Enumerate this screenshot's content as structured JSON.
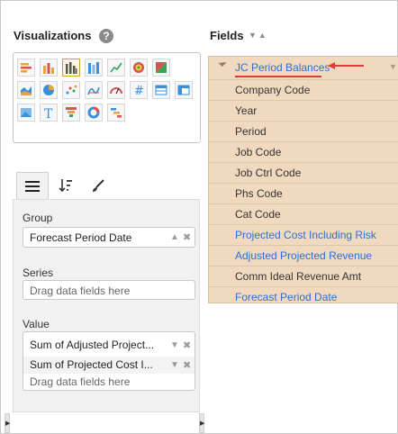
{
  "visualizations": {
    "title": "Visualizations",
    "help_icon": "?",
    "types": [
      {
        "icon": "horizontal-bar-icon"
      },
      {
        "icon": "bar-icon"
      },
      {
        "icon": "stacked-bar-icon",
        "selected": true
      },
      {
        "icon": "clustered-bar-icon"
      },
      {
        "icon": "stacked-column-icon"
      },
      {
        "icon": "line-icon"
      },
      {
        "icon": "gauge-icon"
      },
      {
        "icon": "map-icon"
      },
      {
        "icon": "area-icon"
      },
      {
        "icon": "pie-icon"
      },
      {
        "icon": "scatter-icon"
      },
      {
        "icon": "sparkline-icon"
      },
      {
        "icon": "gauge-meter-icon"
      },
      {
        "icon": "number-icon"
      },
      {
        "icon": "table-icon"
      },
      {
        "icon": "pivot-table-icon"
      },
      {
        "icon": "image-icon"
      },
      {
        "icon": "text-icon"
      },
      {
        "icon": "funnel-icon"
      },
      {
        "icon": "donut-icon"
      },
      {
        "icon": "gantt-icon"
      }
    ]
  },
  "tabs": [
    {
      "icon": "list-icon",
      "active": true
    },
    {
      "icon": "sort-icon",
      "active": false
    },
    {
      "icon": "brush-icon",
      "active": false
    }
  ],
  "group": {
    "label": "Group",
    "value": "Forecast Period Date"
  },
  "series": {
    "label": "Series",
    "placeholder": "Drag data fields here"
  },
  "value": {
    "label": "Value",
    "items": [
      "Sum of Adjusted Project...",
      "Sum of Projected Cost I..."
    ],
    "placeholder": "Drag data fields here"
  },
  "fields": {
    "title": "Fields",
    "sort_glyphs": "▼▲",
    "group_name": "JC Period Balances",
    "items": [
      {
        "label": "Company Code",
        "color": "#333333"
      },
      {
        "label": "Year",
        "color": "#333333"
      },
      {
        "label": "Period",
        "color": "#333333"
      },
      {
        "label": "Job Code",
        "color": "#333333"
      },
      {
        "label": "Job Ctrl Code",
        "color": "#333333"
      },
      {
        "label": "Phs Code",
        "color": "#333333"
      },
      {
        "label": "Cat Code",
        "color": "#333333"
      },
      {
        "label": "Projected Cost Including Risk",
        "color": "#2e6fd1"
      },
      {
        "label": "Adjusted Projected Revenue",
        "color": "#2e6fd1"
      },
      {
        "label": "Comm Ideal Revenue Amt",
        "color": "#333333"
      },
      {
        "label": "Forecast Period Date",
        "color": "#2e6fd1"
      }
    ]
  },
  "colors": {
    "accent": "#c9a227",
    "field_bg": "#f0d9bf",
    "link": "#2e6fd1",
    "annotation": "#e03a3a"
  }
}
